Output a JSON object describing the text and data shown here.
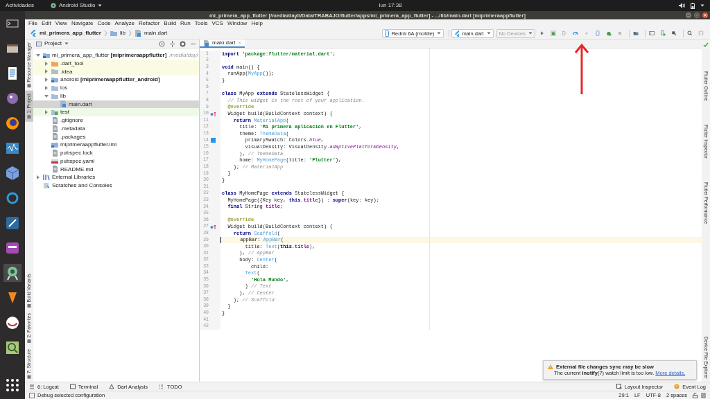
{
  "top_bar": {
    "activities": "Actividades",
    "app_menu": "Android Studio",
    "clock": "lun 17:38"
  },
  "window": {
    "title": "mi_primera_app_flutter [/media/dayli/Data/TRABAJO/flutter/apps/mi_primera_app_flutter] - .../lib/main.dart [miprimeraappflutter]"
  },
  "menu": [
    "File",
    "Edit",
    "View",
    "Navigate",
    "Code",
    "Analyze",
    "Refactor",
    "Build",
    "Run",
    "Tools",
    "VCS",
    "Window",
    "Help"
  ],
  "breadcrumbs": [
    {
      "text": "mi_primera_app_flutter",
      "kind": "project"
    },
    {
      "text": "lib",
      "kind": "folder"
    },
    {
      "text": "main.dart",
      "kind": "file"
    }
  ],
  "run_toolbar": {
    "device": "Redmi 6A (mobile)",
    "config": "main.dart",
    "devices": {
      "text": "No Devices",
      "disabled": true
    }
  },
  "left_tabs": {
    "top": [
      {
        "label": "Resource Manager",
        "selected": false
      },
      {
        "label": "1: Project",
        "selected": true
      }
    ],
    "bottom": [
      {
        "label": "Build Variants",
        "selected": false
      },
      {
        "label": "2: Favorites",
        "selected": false
      },
      {
        "label": "7: Structure",
        "selected": false
      }
    ]
  },
  "right_tabs": {
    "top": [
      "Flutter Outline",
      "Flutter Inspector",
      "Flutter Performance"
    ],
    "bottom": [
      "Device File Explorer"
    ]
  },
  "project": {
    "title": "Project",
    "tree": [
      {
        "label": "mi_primera_app_flutter **[miprimeraappflutter]**",
        "path": "/media/dayl",
        "kind": "module",
        "expanded": true,
        "selected": false,
        "children": [
          {
            "label": ".dart_tool",
            "kind": "folder-excluded",
            "expanded": false,
            "selected": false,
            "color": "#fbfbe3"
          },
          {
            "label": ".idea",
            "kind": "folder",
            "expanded": false,
            "selected": false,
            "color": "#fbfbe3"
          },
          {
            "label": "android **[miprimeraappflutter_android]**",
            "kind": "module",
            "expanded": false,
            "selected": false
          },
          {
            "label": "ios",
            "kind": "folder",
            "expanded": false,
            "selected": false
          },
          {
            "label": "lib",
            "kind": "folder",
            "expanded": true,
            "selected": false,
            "children": [
              {
                "label": "main.dart",
                "kind": "dart",
                "selected": true
              }
            ]
          },
          {
            "label": "test",
            "kind": "folder-test",
            "expanded": false,
            "selected": false,
            "color": "#eefae6"
          },
          {
            "label": ".gitignore",
            "kind": "file",
            "selected": false
          },
          {
            "label": ".metadata",
            "kind": "file",
            "selected": false
          },
          {
            "label": ".packages",
            "kind": "file",
            "selected": false
          },
          {
            "label": "miprimeraappflutter.iml",
            "kind": "module-file",
            "selected": false
          },
          {
            "label": "pubspec.lock",
            "kind": "file",
            "selected": false
          },
          {
            "label": "pubspec.yaml",
            "kind": "yaml",
            "selected": false
          },
          {
            "label": "README.md",
            "kind": "file",
            "selected": false
          }
        ]
      },
      {
        "label": "External Libraries",
        "kind": "library",
        "expanded": false,
        "selected": false
      },
      {
        "label": "Scratches and Consoles",
        "kind": "scratch",
        "selected": false
      }
    ]
  },
  "editor": {
    "tabs": [
      {
        "label": "main.dart",
        "close": "×",
        "selected": true
      }
    ],
    "lines": [
      {
        "n": "1",
        "current": false,
        "parts": [
          {
            "text": "import ",
            "kind": "kw"
          },
          {
            "text": "'package:flutter/material.dart'",
            "kind": "str"
          },
          {
            "text": ";",
            "kind": "txt"
          }
        ]
      },
      {
        "n": "2",
        "current": false
      },
      {
        "n": "3",
        "current": false,
        "parts": [
          {
            "text": "void ",
            "kind": "kw"
          },
          {
            "text": "main() {",
            "kind": "txt"
          }
        ]
      },
      {
        "n": "4",
        "current": false,
        "parts": [
          {
            "text": "  runApp(",
            "kind": "txt"
          },
          {
            "text": "MyApp",
            "kind": "cls"
          },
          {
            "text": "());",
            "kind": "txt"
          }
        ]
      },
      {
        "n": "5",
        "current": false,
        "parts": [
          {
            "text": "}",
            "kind": "txt"
          }
        ]
      },
      {
        "n": "6",
        "current": false
      },
      {
        "n": "7",
        "current": false,
        "parts": [
          {
            "text": "class ",
            "kind": "kw"
          },
          {
            "text": "MyApp ",
            "kind": "txt"
          },
          {
            "text": "extends ",
            "kind": "kw"
          },
          {
            "text": "StatelessWidget {",
            "kind": "txt"
          }
        ]
      },
      {
        "n": "8",
        "current": false,
        "parts": [
          {
            "text": "  // This widget is the root of your application.",
            "kind": "cmt"
          }
        ]
      },
      {
        "n": "9",
        "current": false,
        "parts": [
          {
            "text": "  @override",
            "kind": "ann"
          }
        ]
      },
      {
        "n": "10",
        "current": false,
        "gutter": {
          "kind": "override"
        },
        "parts": [
          {
            "text": "  Widget build(BuildContext context) {",
            "kind": "txt"
          }
        ]
      },
      {
        "n": "11",
        "current": false,
        "parts": [
          {
            "text": "    return ",
            "kind": "kw"
          },
          {
            "text": "MaterialApp",
            "kind": "cls"
          },
          {
            "text": "(",
            "kind": "txt"
          }
        ]
      },
      {
        "n": "12",
        "current": false,
        "parts": [
          {
            "text": "      title: ",
            "kind": "txt"
          },
          {
            "text": "'Mi primera aplicacion en Flutter'",
            "kind": "str"
          },
          {
            "text": ",",
            "kind": "txt"
          }
        ]
      },
      {
        "n": "13",
        "current": false,
        "parts": [
          {
            "text": "      theme: ",
            "kind": "txt"
          },
          {
            "text": "ThemeData",
            "kind": "cls"
          },
          {
            "text": "(",
            "kind": "txt"
          }
        ]
      },
      {
        "n": "14",
        "current": false,
        "gutter": {
          "kind": "swatch",
          "color": "#2196f3"
        },
        "parts": [
          {
            "text": "        primarySwatch: Colors.",
            "kind": "txt"
          },
          {
            "text": "blue",
            "kind": "prop"
          },
          {
            "text": ",",
            "kind": "txt"
          }
        ]
      },
      {
        "n": "15",
        "current": false,
        "parts": [
          {
            "text": "        visualDensity: VisualDensity.",
            "kind": "txt"
          },
          {
            "text": "adaptivePlatformDensity",
            "kind": "prop"
          },
          {
            "text": ",",
            "kind": "txt"
          }
        ]
      },
      {
        "n": "16",
        "current": false,
        "parts": [
          {
            "text": "      ), ",
            "kind": "txt"
          },
          {
            "text": "// ThemeData",
            "kind": "cmt"
          }
        ]
      },
      {
        "n": "17",
        "current": false,
        "parts": [
          {
            "text": "      home: ",
            "kind": "txt"
          },
          {
            "text": "MyHomePage",
            "kind": "cls"
          },
          {
            "text": "(title: ",
            "kind": "txt"
          },
          {
            "text": "'Flutter'",
            "kind": "str"
          },
          {
            "text": "),",
            "kind": "txt"
          }
        ]
      },
      {
        "n": "18",
        "current": false,
        "parts": [
          {
            "text": "    ); ",
            "kind": "txt"
          },
          {
            "text": "// MaterialApp",
            "kind": "cmt"
          }
        ]
      },
      {
        "n": "19",
        "current": false,
        "parts": [
          {
            "text": "  }",
            "kind": "txt"
          }
        ]
      },
      {
        "n": "20",
        "current": false,
        "parts": [
          {
            "text": "}",
            "kind": "txt"
          }
        ]
      },
      {
        "n": "21",
        "current": false
      },
      {
        "n": "22",
        "current": false,
        "parts": [
          {
            "text": "class ",
            "kind": "kw"
          },
          {
            "text": "MyHomePage ",
            "kind": "txt"
          },
          {
            "text": "extends ",
            "kind": "kw"
          },
          {
            "text": "StatelessWidget {",
            "kind": "txt"
          }
        ]
      },
      {
        "n": "23",
        "current": false,
        "parts": [
          {
            "text": "  MyHomePage({Key key, ",
            "kind": "txt"
          },
          {
            "text": "this",
            "kind": "kw"
          },
          {
            "text": ".",
            "kind": "txt"
          },
          {
            "text": "title",
            "kind": "fld"
          },
          {
            "text": "}) : ",
            "kind": "txt"
          },
          {
            "text": "super",
            "kind": "kw"
          },
          {
            "text": "(key: key);",
            "kind": "txt"
          }
        ]
      },
      {
        "n": "24",
        "current": false,
        "parts": [
          {
            "text": "  final ",
            "kind": "kw"
          },
          {
            "text": "String ",
            "kind": "txt"
          },
          {
            "text": "title",
            "kind": "fld"
          },
          {
            "text": ";",
            "kind": "txt"
          }
        ]
      },
      {
        "n": "25",
        "current": false
      },
      {
        "n": "26",
        "current": false,
        "parts": [
          {
            "text": "  @override",
            "kind": "ann"
          }
        ]
      },
      {
        "n": "27",
        "current": false,
        "gutter": {
          "kind": "override"
        },
        "parts": [
          {
            "text": "  Widget build(BuildContext context) {",
            "kind": "txt"
          }
        ]
      },
      {
        "n": "28",
        "current": false,
        "parts": [
          {
            "text": "    return ",
            "kind": "kw"
          },
          {
            "text": "Scaffold",
            "kind": "cls"
          },
          {
            "text": "(",
            "kind": "txt"
          }
        ]
      },
      {
        "n": "29",
        "current": true,
        "parts": [
          {
            "text": "      appBar: ",
            "kind": "txt"
          },
          {
            "text": "AppBar",
            "kind": "cls"
          },
          {
            "text": "(",
            "kind": "txt"
          }
        ]
      },
      {
        "n": "30",
        "current": false,
        "parts": [
          {
            "text": "        title: ",
            "kind": "txt"
          },
          {
            "text": "Text",
            "kind": "cls"
          },
          {
            "text": "(",
            "kind": "txt"
          },
          {
            "text": "this",
            "kind": "kw"
          },
          {
            "text": ".",
            "kind": "txt"
          },
          {
            "text": "title",
            "kind": "fld"
          },
          {
            "text": "),",
            "kind": "txt"
          }
        ]
      },
      {
        "n": "31",
        "current": false,
        "parts": [
          {
            "text": "      ), ",
            "kind": "txt"
          },
          {
            "text": "// AppBar",
            "kind": "cmt"
          }
        ]
      },
      {
        "n": "32",
        "current": false,
        "parts": [
          {
            "text": "      body: ",
            "kind": "txt"
          },
          {
            "text": "Center",
            "kind": "cls"
          },
          {
            "text": "(",
            "kind": "txt"
          }
        ]
      },
      {
        "n": "33",
        "current": false,
        "parts": [
          {
            "text": "          child:",
            "kind": "txt"
          }
        ]
      },
      {
        "n": "34",
        "current": false,
        "parts": [
          {
            "text": "        Text",
            "kind": "cls"
          },
          {
            "text": "(",
            "kind": "txt"
          }
        ]
      },
      {
        "n": "35",
        "current": false,
        "parts": [
          {
            "text": "          'Hola Mundo'",
            "kind": "str"
          },
          {
            "text": ",",
            "kind": "txt"
          }
        ]
      },
      {
        "n": "36",
        "current": false,
        "parts": [
          {
            "text": "        ) ",
            "kind": "txt"
          },
          {
            "text": "// Text",
            "kind": "cmt"
          }
        ]
      },
      {
        "n": "37",
        "current": false,
        "parts": [
          {
            "text": "      ), ",
            "kind": "txt"
          },
          {
            "text": "// Center",
            "kind": "cmt"
          }
        ]
      },
      {
        "n": "38",
        "current": false,
        "parts": [
          {
            "text": "    ); ",
            "kind": "txt"
          },
          {
            "text": "// Scaffold",
            "kind": "cmt"
          }
        ]
      },
      {
        "n": "39",
        "current": false,
        "parts": [
          {
            "text": "  }",
            "kind": "txt"
          }
        ]
      },
      {
        "n": "40",
        "current": false,
        "parts": [
          {
            "text": "}",
            "kind": "txt"
          }
        ]
      },
      {
        "n": "41",
        "current": false
      },
      {
        "n": "42",
        "current": false
      }
    ]
  },
  "notification": {
    "title": "External file changes sync may be slow",
    "body": "The current **inotify**(7) watch limit is too low.",
    "link": "More details."
  },
  "tool_windows": {
    "left": [
      "6: Logcat",
      "Terminal",
      "Dart Analysis",
      "TODO"
    ],
    "right": [
      "Layout Inspector",
      "Event Log"
    ]
  },
  "status_bar": {
    "message": "Debug selected configuration",
    "items": [
      "29:1",
      "LF",
      "UTF-8",
      "2 spaces"
    ]
  }
}
